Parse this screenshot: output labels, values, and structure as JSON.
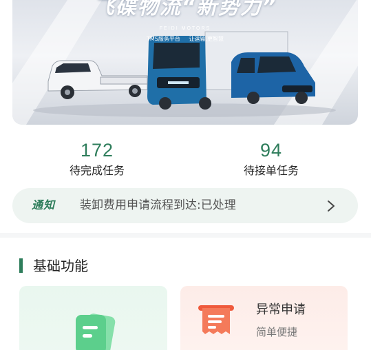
{
  "banner": {
    "headline": "飞碟物流“新势力”",
    "brand": "FEIDI MOTORS",
    "slogan": "TMS服务平台  让运输,更智慧"
  },
  "stats": [
    {
      "value": "172",
      "label": "待完成任务"
    },
    {
      "value": "94",
      "label": "待接单任务"
    }
  ],
  "notice": {
    "tag": "通知",
    "text": "装卸费用申请流程到达:已处理",
    "arrow_icon": "chevron-right-icon"
  },
  "section": {
    "title": "基础功能",
    "cards": [
      {
        "title": "",
        "subtitle": "",
        "icon": "document-icon"
      },
      {
        "title": "异常申请",
        "subtitle": "简单便捷",
        "icon": "receipt-icon"
      }
    ]
  },
  "colors": {
    "accent": "#2e7d5b",
    "notice_bg": "#eef4f1",
    "card_green": "#e9f7ef",
    "card_red": "#fdece8",
    "receipt": "#ef5a3c"
  }
}
